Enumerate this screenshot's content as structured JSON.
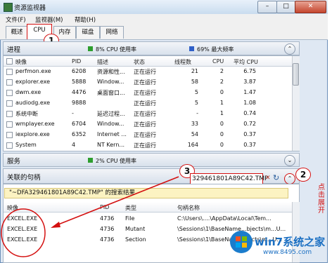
{
  "window": {
    "title": "资源监视器",
    "min": "–",
    "max": "□",
    "close": "✕"
  },
  "menu": [
    "文件(F)",
    "监视器(M)",
    "帮助(H)"
  ],
  "tabs": [
    "概述",
    "CPU",
    "内存",
    "磁盘",
    "网络"
  ],
  "callouts": [
    "1",
    "2",
    "3"
  ],
  "process_section": {
    "title": "进程",
    "cpu_usage": "8% CPU 使用率",
    "max_freq": "69% 最大频率",
    "cpu_legend_color": "#2e9e2e",
    "freq_legend_color": "#3060c8",
    "columns": [
      "映像",
      "PID",
      "描述",
      "状态",
      "线程数",
      "CPU",
      "平均 CPU"
    ],
    "rows": [
      {
        "image": "perfmon.exe",
        "pid": "6208",
        "desc": "资源和性...",
        "status": "正在运行",
        "threads": "21",
        "cpu": "2",
        "avg": "6.75"
      },
      {
        "image": "explorer.exe",
        "pid": "5888",
        "desc": "Window...",
        "status": "正在运行",
        "threads": "58",
        "cpu": "2",
        "avg": "3.87"
      },
      {
        "image": "dwm.exe",
        "pid": "4476",
        "desc": "桌面窗口...",
        "status": "正在运行",
        "threads": "5",
        "cpu": "0",
        "avg": "1.47"
      },
      {
        "image": "audiodg.exe",
        "pid": "9888",
        "desc": "",
        "status": "正在运行",
        "threads": "5",
        "cpu": "1",
        "avg": "1.08"
      },
      {
        "image": "系统中断",
        "pid": "-",
        "desc": "延迟过程...",
        "status": "正在运行",
        "threads": "-",
        "cpu": "1",
        "avg": "0.74"
      },
      {
        "image": "wmplayer.exe",
        "pid": "6704",
        "desc": "Window...",
        "status": "正在运行",
        "threads": "33",
        "cpu": "0",
        "avg": "0.72"
      },
      {
        "image": "iexplore.exe",
        "pid": "6352",
        "desc": "Internet ...",
        "status": "正在运行",
        "threads": "54",
        "cpu": "0",
        "avg": "0.37"
      },
      {
        "image": "System",
        "pid": "4",
        "desc": "NT Kern...",
        "status": "正在运行",
        "threads": "164",
        "cpu": "0",
        "avg": "0.37"
      }
    ]
  },
  "services_section": {
    "title": "服务",
    "cpu_usage": "2% CPU 使用率"
  },
  "handles_section": {
    "title": "关联的句柄",
    "search_value": "329461801A89C42.TMP",
    "clear_icon": "✕",
    "refresh_icon": "↻",
    "result_text": "\"~DFA329461801A89C42.TMP\" 的搜索结果",
    "columns": [
      "映像",
      "PID",
      "类型",
      "句柄名称"
    ],
    "rows": [
      {
        "image": "EXCEL.EXE",
        "pid": "4736",
        "type": "File",
        "handle": "C:\\Users\\....\\AppData\\Local\\Tem..."
      },
      {
        "image": "EXCEL.EXE",
        "pid": "4736",
        "type": "Mutant",
        "handle": "\\Sessions\\1\\BaseName...bjects\\m...U..."
      },
      {
        "image": "EXCEL.EXE",
        "pid": "4736",
        "type": "Section",
        "handle": "\\Sessions\\1\\BaseName...jects\\m...U..."
      }
    ]
  },
  "annotation": "点击展开",
  "watermark": {
    "brand": "win7系统之家",
    "url": "www.8495.com"
  }
}
